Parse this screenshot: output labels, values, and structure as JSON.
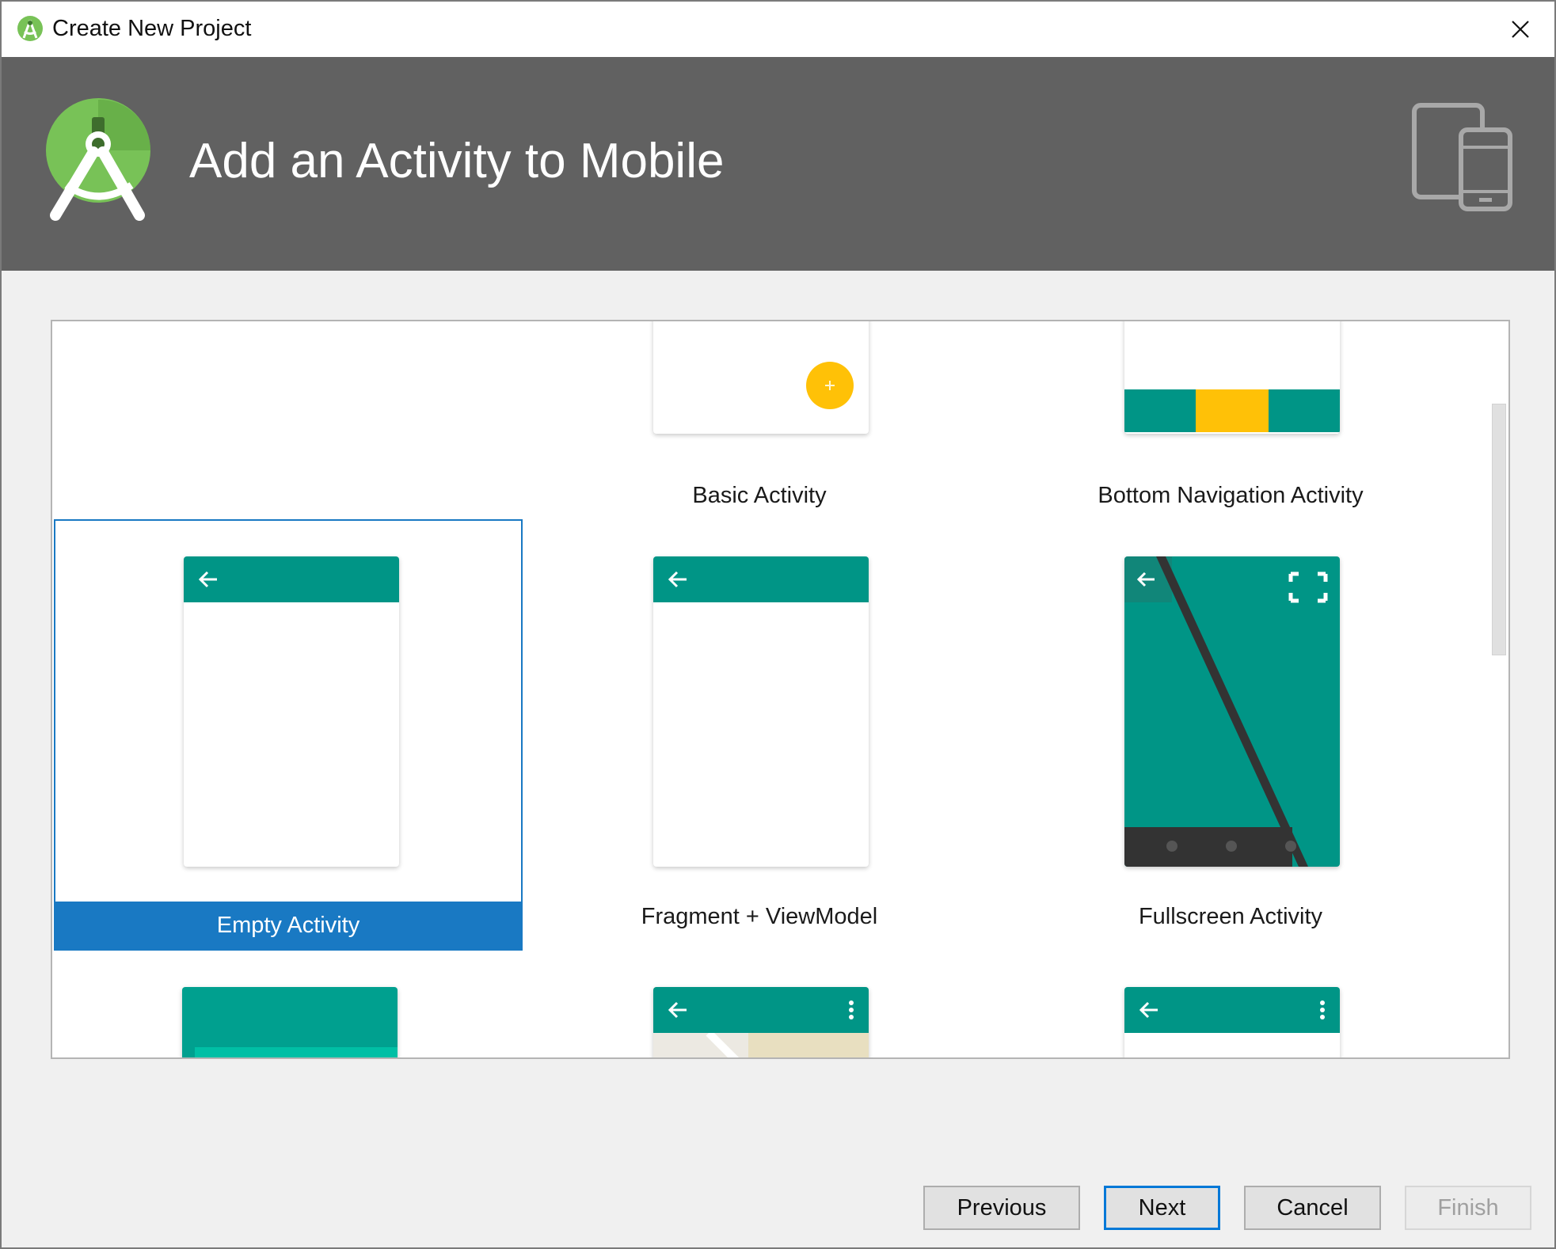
{
  "window": {
    "title": "Create New Project",
    "close_icon": "close-icon"
  },
  "banner": {
    "heading": "Add an Activity to Mobile",
    "logo_icon": "android-studio-logo-icon",
    "device_icon": "tablet-phone-icon"
  },
  "templates": [
    {
      "label": "",
      "selected": false
    },
    {
      "label": "Basic Activity",
      "selected": false
    },
    {
      "label": "Bottom Navigation Activity",
      "selected": false
    },
    {
      "label": "Empty Activity",
      "selected": true
    },
    {
      "label": "Fragment + ViewModel",
      "selected": false
    },
    {
      "label": "Fullscreen Activity",
      "selected": false
    }
  ],
  "buttons": {
    "previous": "Previous",
    "next": "Next",
    "cancel": "Cancel",
    "finish": "Finish"
  },
  "colors": {
    "accent": "#1979c3",
    "teal": "#009586",
    "amber": "#ffc107",
    "banner": "#616161"
  }
}
